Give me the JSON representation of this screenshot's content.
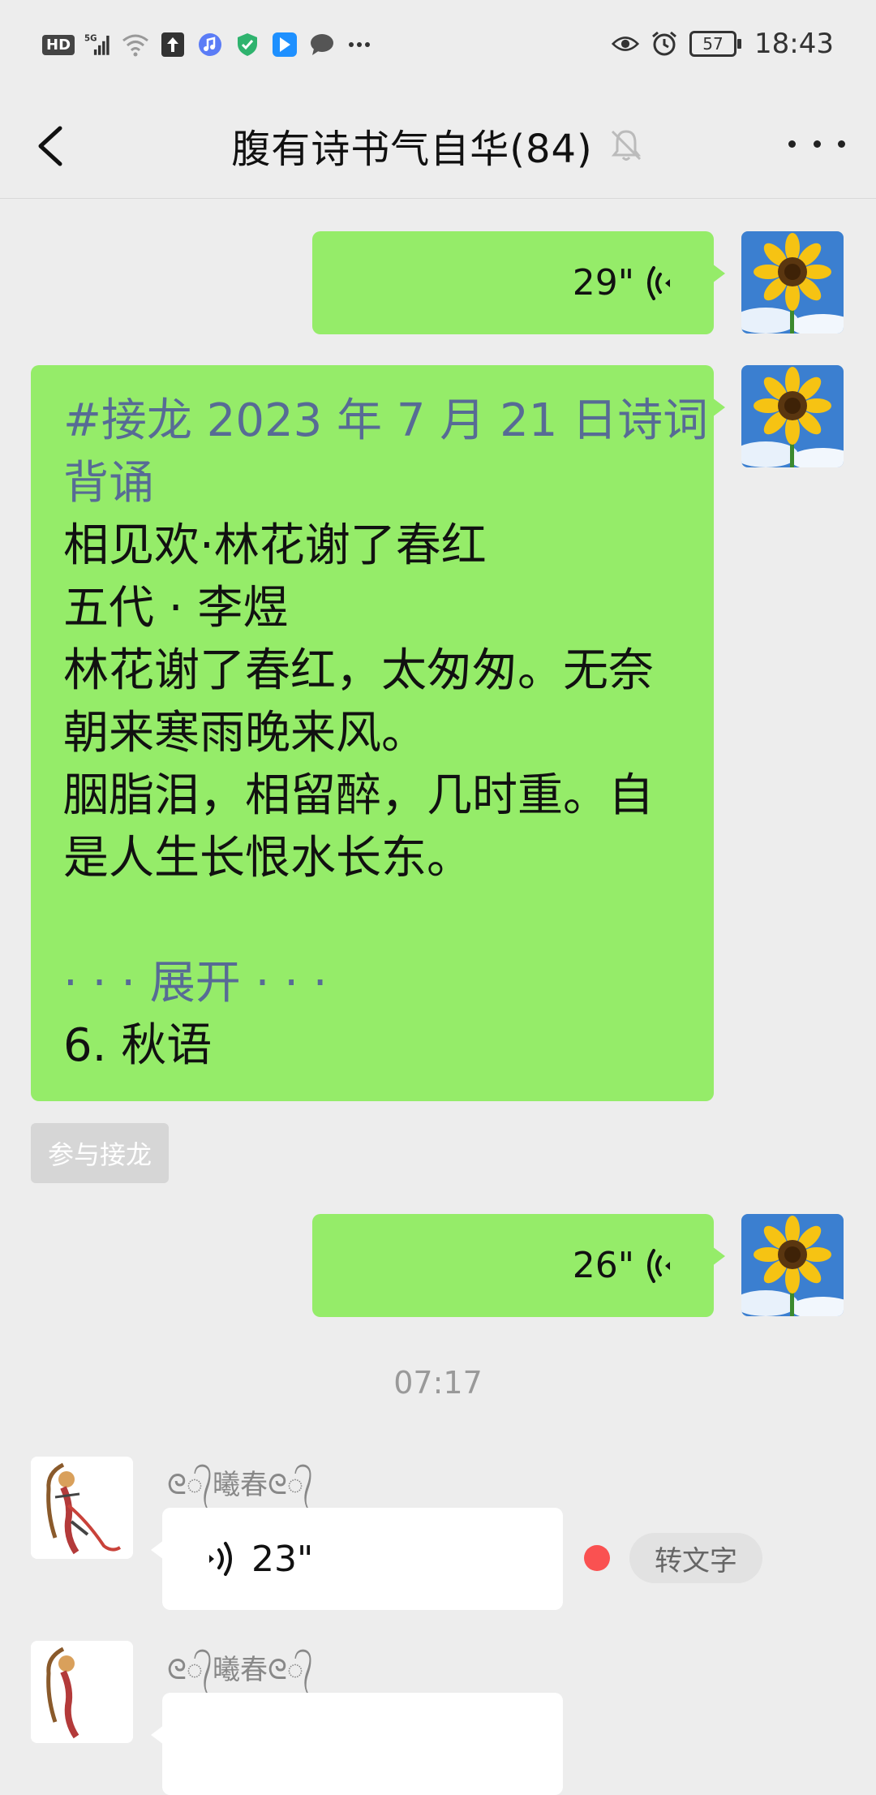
{
  "status_bar": {
    "hd_label": "HD",
    "network_label": "5G",
    "battery_level": "57",
    "time": "18:43"
  },
  "nav": {
    "title": "腹有诗书气自华(84)",
    "back_icon": "chevron-left-icon",
    "mute_icon": "bell-off-icon",
    "more_icon": "more-icon"
  },
  "messages": [
    {
      "type": "voice",
      "side": "right",
      "duration": "29\""
    },
    {
      "type": "text",
      "side": "right",
      "lines": [
        "#接龙 2023 年 7 月 21 日诗词",
        "背诵",
        "相见欢·林花谢了春红",
        "五代 · 李煜",
        "林花谢了春红，太匆匆。无奈",
        "朝来寒雨晚来风。",
        "胭脂泪，相留醉，几时重。自",
        "是人生长恨水长东。",
        "",
        "· · · 展开 · · ·",
        "6. 秋语"
      ]
    },
    {
      "type": "voice",
      "side": "right",
      "duration": "26\""
    },
    {
      "type": "voice",
      "side": "left",
      "sender": "ᘓ᭄曦春ᘓ᭄",
      "duration": "23\"",
      "unread": true
    }
  ],
  "jielong_button": "参与接龙",
  "timestamp": "07:17",
  "convert_to_text": "转文字",
  "partial_sender": "ᘓ᭄曦春ᘓ᭄",
  "colors": {
    "self_bubble": "#95ec69",
    "other_bubble": "#ffffff",
    "link_text": "#576b95",
    "unread_dot": "#fa5151",
    "background": "#ededed"
  }
}
